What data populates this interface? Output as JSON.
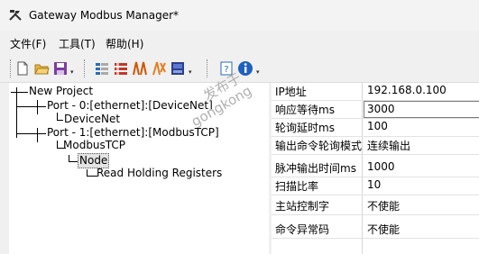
{
  "window": {
    "title": "Gateway Modbus Manager*"
  },
  "menu": {
    "file": "文件(F)",
    "tools": "工具(T)",
    "help": "帮助(H)"
  },
  "tree": {
    "root": "New Project",
    "port0": "Port - 0:[ethernet]:[DeviceNet]",
    "devicenet": "DeviceNet",
    "port1": "Port - 1:[ethernet]:[ModbusTCP]",
    "modbustcp": "ModbusTCP",
    "node": "Node",
    "read_holding": "Read Holding Registers"
  },
  "properties": [
    {
      "name": "IP地址",
      "value": "192.168.0.100"
    },
    {
      "name": "响应等待ms",
      "value": "3000"
    },
    {
      "name": "轮询延时ms",
      "value": "100"
    },
    {
      "name": "输出命令轮询模式",
      "value": "连续输出"
    },
    {
      "name": "脉冲输出时间ms",
      "value": "1000"
    },
    {
      "name": "扫描比率",
      "value": "10"
    },
    {
      "name": "主站控制字",
      "value": "不使能"
    },
    {
      "name": "命令异常码",
      "value": "不使能"
    }
  ],
  "watermark": {
    "line1": "发布于",
    "line2": "gongkong"
  }
}
